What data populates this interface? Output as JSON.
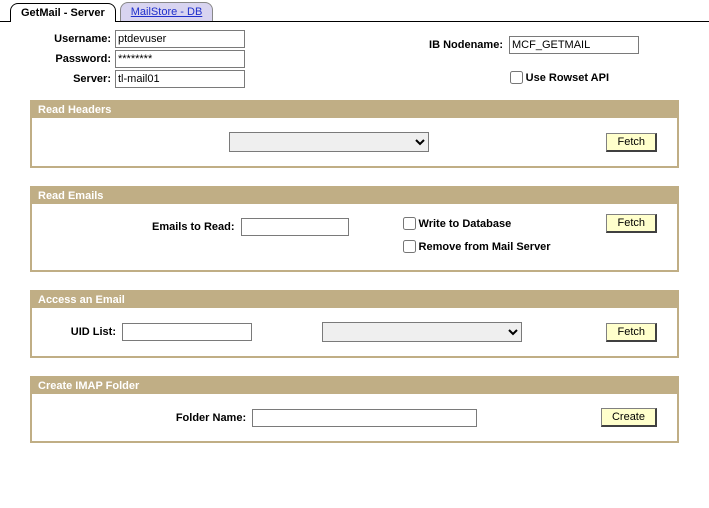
{
  "tabs": {
    "active": "GetMail - Server",
    "inactive": "MailStore - DB"
  },
  "form": {
    "username_label": "Username:",
    "username_value": "ptdevuser",
    "password_label": "Password:",
    "password_value": "********",
    "server_label": "Server:",
    "server_value": "tl-mail01",
    "ib_nodename_label": "IB Nodename:",
    "ib_nodename_value": "MCF_GETMAIL",
    "use_rowset_label": "Use Rowset API"
  },
  "panels": {
    "read_headers": {
      "title": "Read Headers",
      "fetch_label": "Fetch"
    },
    "read_emails": {
      "title": "Read Emails",
      "emails_to_read_label": "Emails to Read:",
      "write_db_label": "Write to Database",
      "remove_label": "Remove from Mail Server",
      "fetch_label": "Fetch"
    },
    "access_email": {
      "title": "Access an Email",
      "uid_list_label": "UID List:",
      "fetch_label": "Fetch"
    },
    "create_folder": {
      "title": "Create IMAP Folder",
      "folder_name_label": "Folder Name:",
      "create_label": "Create"
    }
  }
}
